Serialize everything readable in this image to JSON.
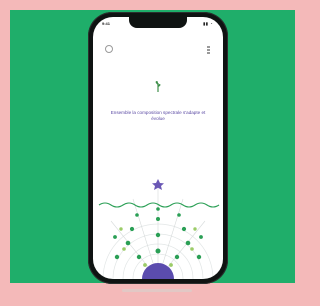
{
  "background": {
    "frame_color": "#f4b9b9",
    "panel_color": "#1fae6a"
  },
  "phone": {
    "status_time": "9:41",
    "status_icons": "▮▮ ◔",
    "caption": "Ensemble la composition spectrale s'adapte et évolue",
    "icons": {
      "left": "settings-icon",
      "right": "menu-icon",
      "center": "plant-icon"
    }
  }
}
